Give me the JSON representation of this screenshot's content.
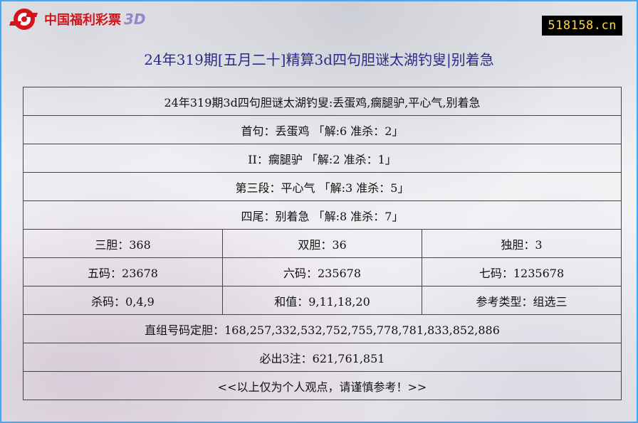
{
  "brand": {
    "name": "中国福利彩票",
    "game": "3D"
  },
  "site_badge": "518158.cn",
  "page_title": "24年319期[五月二十]精算3d四句胆谜太湖钓叟|别着急",
  "table": {
    "riddle_line": "24年319期3d四句胆谜太湖钓叟:丢蛋鸡,瘸腿驴,平心气,别着急",
    "line1": "首句：丢蛋鸡 「解:6 准杀：2」",
    "line2": "II：瘸腿驴 「解:2 准杀：1」",
    "line3": "第三段：平心气 「解:3 准杀：5」",
    "line4": "四尾：别着急 「解:8 准杀：7」",
    "three_dan": "三胆：368",
    "two_dan": "双胆：36",
    "one_dan": "独胆：3",
    "five_code": "五码：23678",
    "six_code": "六码：235678",
    "seven_code": "七码：1235678",
    "kill_code": "杀码：0,4,9",
    "sum_value": "和值：9,11,18,20",
    "ref_type": "参考类型：组选三",
    "direct_group": "直组号码定胆：168,257,332,532,752,755,778,781,833,852,886",
    "must_bets": "必出3注：621,761,851",
    "disclaimer": "<<以上仅为个人观点，请谨慎参考！>>"
  },
  "colors": {
    "brand_red": "#d2141c",
    "brand_3d": "#9a84c9",
    "title": "#2a2a8a",
    "frame_border": "#3fa8ff",
    "badge_bg": "#000000",
    "badge_text": "#ffd83a"
  }
}
